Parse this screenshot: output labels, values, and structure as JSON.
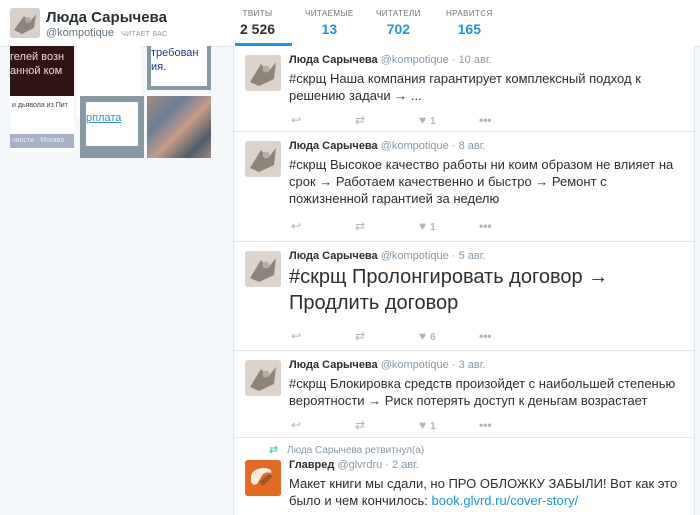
{
  "profile": {
    "name": "Люда Сарычева",
    "handle": "@kompotique",
    "follows_you": "ЧИТАЕТ ВАС"
  },
  "stats": [
    {
      "label": "ТВИТЫ",
      "value": "2 526"
    },
    {
      "label": "ЧИТАЕМЫЕ",
      "value": "13"
    },
    {
      "label": "ЧИТАТЕЛИ",
      "value": "702"
    },
    {
      "label": "НРАВИТСЯ",
      "value": "165"
    }
  ],
  "media_snippets": {
    "m1": "гелей возн\nанной ком",
    "m3": "требован\nия.",
    "m4_top": "и дьявола из Пит",
    "m4_bar": "овости · Москва",
    "m5": "рплата"
  },
  "tweets": [
    {
      "name": "Люда Сарычева",
      "handle": "@kompotique",
      "date": "· 10 авг.",
      "text": "#скрщ Наша компания гарантирует комплексный подход к решению задачи → ...",
      "likes": "1"
    },
    {
      "name": "Люда Сарычева",
      "handle": "@kompotique",
      "date": "· 8 авг.",
      "text": "#скрщ Высокое качество работы ни коим образом не влияет на срок → Работаем качественно и быстро → Ремонт с пожизненной гарантией за неделю",
      "likes": "1"
    },
    {
      "name": "Люда Сарычева",
      "handle": "@kompotique",
      "date": "· 5 авг.",
      "text": "#скрщ Пролонгировать договор → Продлить договор",
      "likes": "6"
    },
    {
      "name": "Люда Сарычева",
      "handle": "@kompotique",
      "date": "· 3 авг.",
      "text": "#скрщ Блокировка средств произойдет с наибольшей степенью вероятности → Риск потерять доступ к деньгам возрастает",
      "likes": "1"
    }
  ],
  "retweet": {
    "context": "Люда Сарычева ретвитнул(а)",
    "name": "Главред",
    "handle": "@glvrdru",
    "date": "· 2 авг.",
    "text": "Макет книги мы сдали, но ПРО ОБЛОЖКУ ЗАБЫЛИ! Вот как это было и чем кончилось: ",
    "link": "book.glvrd.ru/cover-story/"
  },
  "icons": {
    "reply": "reply-icon",
    "retweet": "retweet-icon",
    "like": "heart-icon",
    "more": "more-icon"
  },
  "colors": {
    "accent": "#1b95e0",
    "retweet_green": "#19cf86",
    "muted": "#8899a6"
  }
}
